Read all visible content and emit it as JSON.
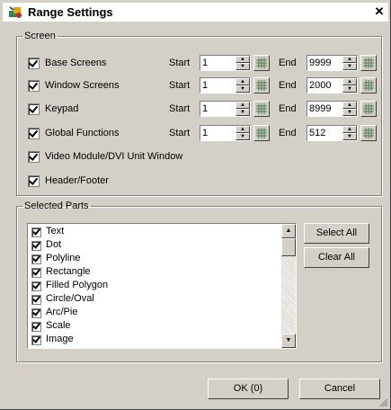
{
  "window": {
    "title": "Range Settings",
    "close_glyph": "✕"
  },
  "screen": {
    "legend": "Screen",
    "start_label": "Start",
    "end_label": "End",
    "rows": [
      {
        "label": "Base Screens",
        "start": "1",
        "end": "9999",
        "checked": true
      },
      {
        "label": "Window Screens",
        "start": "1",
        "end": "2000",
        "checked": true
      },
      {
        "label": "Keypad",
        "start": "1",
        "end": "8999",
        "checked": true
      },
      {
        "label": "Global Functions",
        "start": "1",
        "end": "512",
        "checked": true
      }
    ],
    "video_module": {
      "label": "Video Module/DVI Unit Window",
      "checked": true
    },
    "header_footer": {
      "label": "Header/Footer",
      "checked": true
    }
  },
  "selected_parts": {
    "legend": "Selected Parts",
    "items": [
      {
        "label": "Text",
        "checked": true
      },
      {
        "label": "Dot",
        "checked": true
      },
      {
        "label": "Polyline",
        "checked": true
      },
      {
        "label": "Rectangle",
        "checked": true
      },
      {
        "label": "Filled Polygon",
        "checked": true
      },
      {
        "label": "Circle/Oval",
        "checked": true
      },
      {
        "label": "Arc/Pie",
        "checked": true
      },
      {
        "label": "Scale",
        "checked": true
      },
      {
        "label": "Image",
        "checked": true
      }
    ],
    "select_all": "Select All",
    "clear_all": "Clear All"
  },
  "footer": {
    "ok": "OK (0)",
    "cancel": "Cancel"
  },
  "icons": {
    "title": "app-icon",
    "spin": "spin-arrows-icon",
    "grid": "grid-icon"
  }
}
